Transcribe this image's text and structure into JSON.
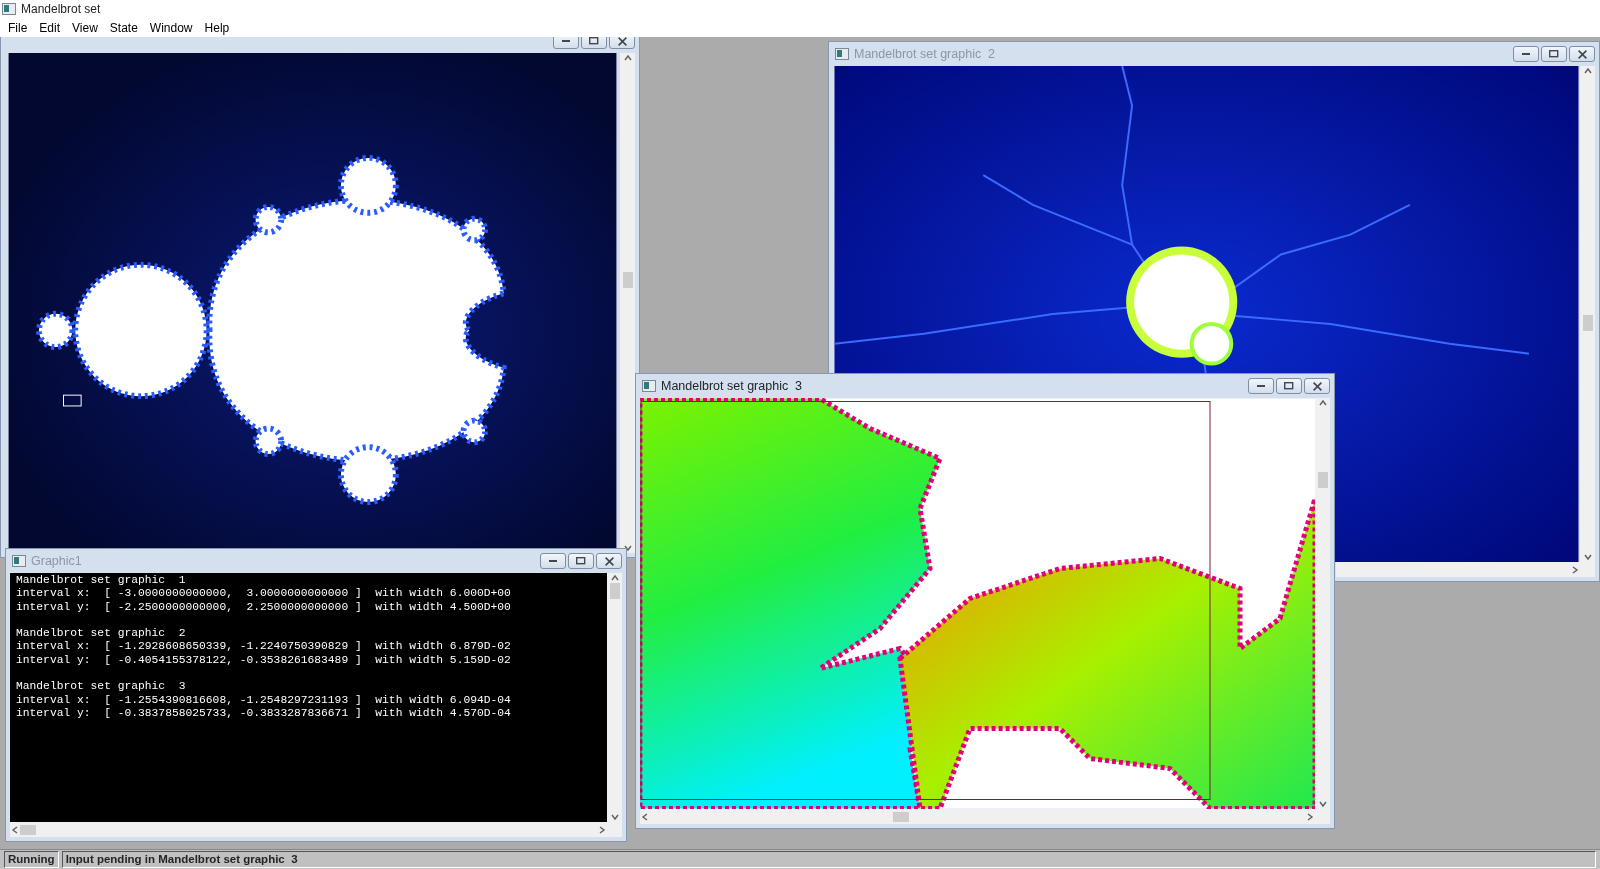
{
  "app": {
    "title": "Mandelbrot set"
  },
  "menu": [
    "File",
    "Edit",
    "View",
    "State",
    "Window",
    "Help"
  ],
  "windows": [
    {
      "kind": "overview",
      "selection": true
    },
    {
      "kind": "zoom",
      "title": "Mandelbrot set graphic  2",
      "active": false
    },
    {
      "kind": "console",
      "title": "Graphic1",
      "active": false,
      "blocks": [
        {
          "lines": [
            "Mandelbrot set graphic  1",
            "interval x:  [ -3.0000000000000,  3.0000000000000 ]  with width 6.000D+00",
            "interval y:  [ -2.2500000000000,  2.2500000000000 ]  with width 4.500D+00"
          ]
        },
        {
          "lines": [
            "Mandelbrot set graphic  2",
            "interval x:  [ -1.2928608650339, -1.2240750390829 ]  with width 6.879D-02",
            "interval y:  [ -0.4054155378122, -0.3538261683489 ]  with width 5.159D-02"
          ]
        },
        {
          "lines": [
            "Mandelbrot set graphic  3",
            "interval x:  [ -1.2554390816608, -1.2548297231193 ]  with width 6.094D-04",
            "interval y:  [ -0.3837858025733, -0.3833287836671 ]  with width 4.570D-04"
          ]
        }
      ]
    },
    {
      "kind": "detail",
      "title": "Mandelbrot set graphic  3",
      "active": true,
      "selection": true
    }
  ],
  "status_bar": {
    "state": "Running",
    "message": "Input pending in Mandelbrot set graphic  3"
  }
}
